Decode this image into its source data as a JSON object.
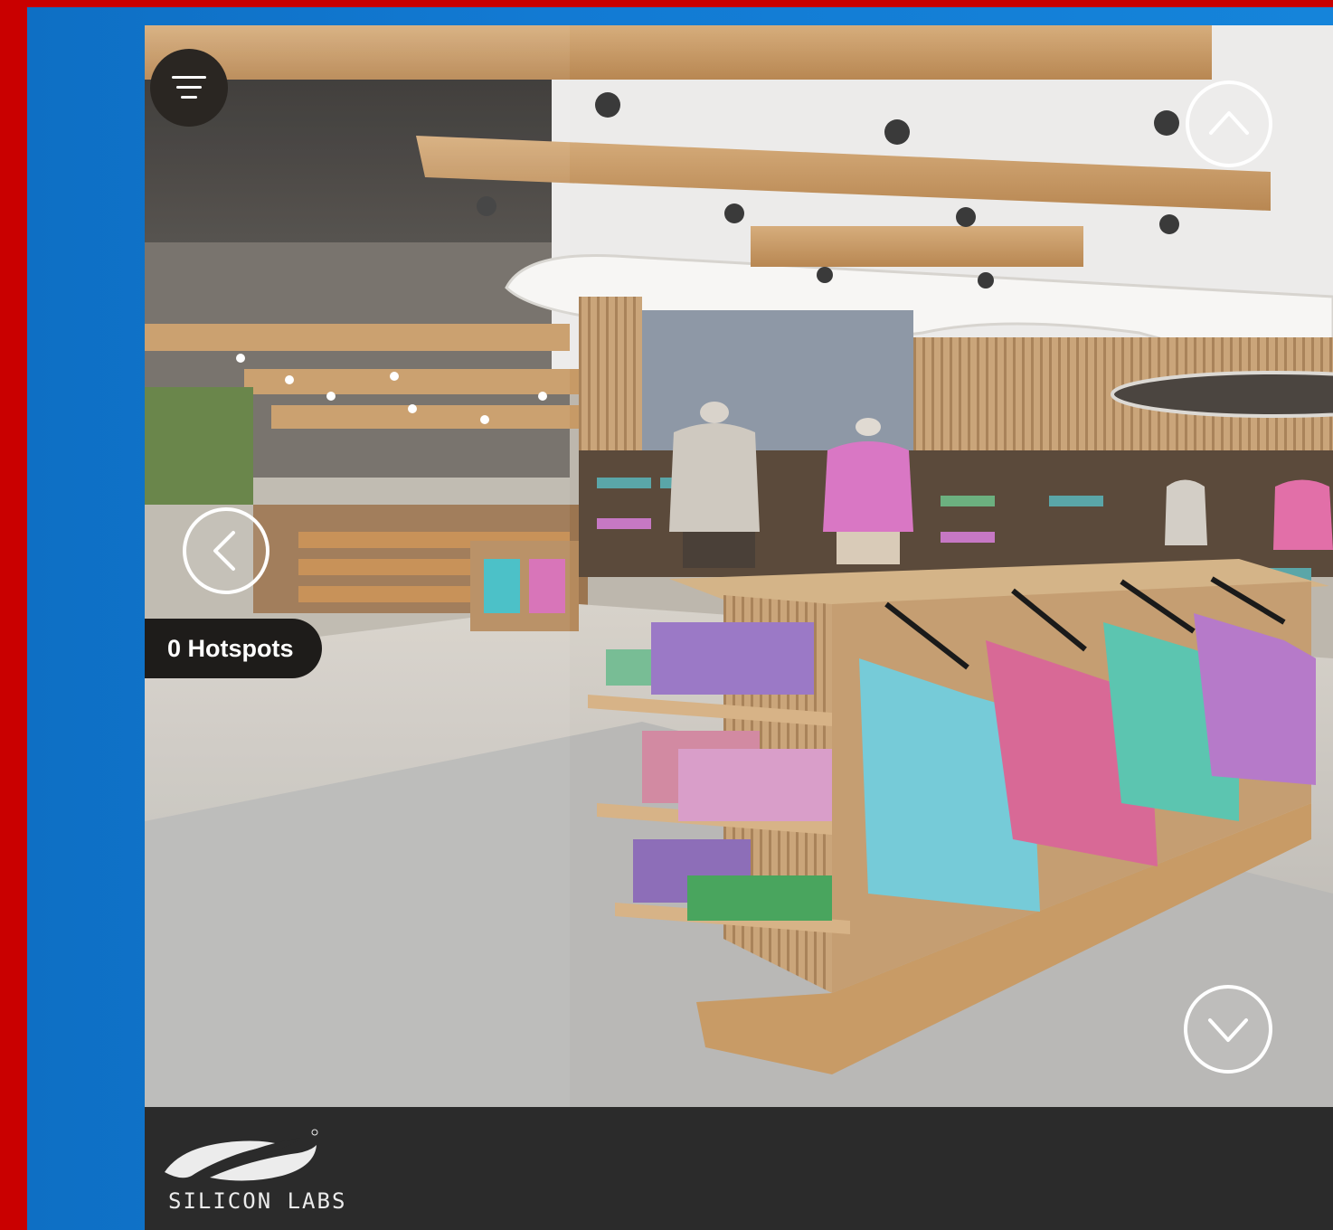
{
  "viewer": {
    "hotspots_label": "0 Hotspots",
    "menu_icon": "filter-menu-icon",
    "nav_icons": [
      "chevron-up-icon",
      "chevron-left-icon",
      "chevron-down-icon"
    ]
  },
  "footer": {
    "logo_text": "SILICON LABS"
  },
  "colors": {
    "frame_red": "#c90000",
    "frame_blue": "#1584da",
    "footer_bg": "#2b2b2b",
    "pill_bg": "#1e1c1a"
  }
}
